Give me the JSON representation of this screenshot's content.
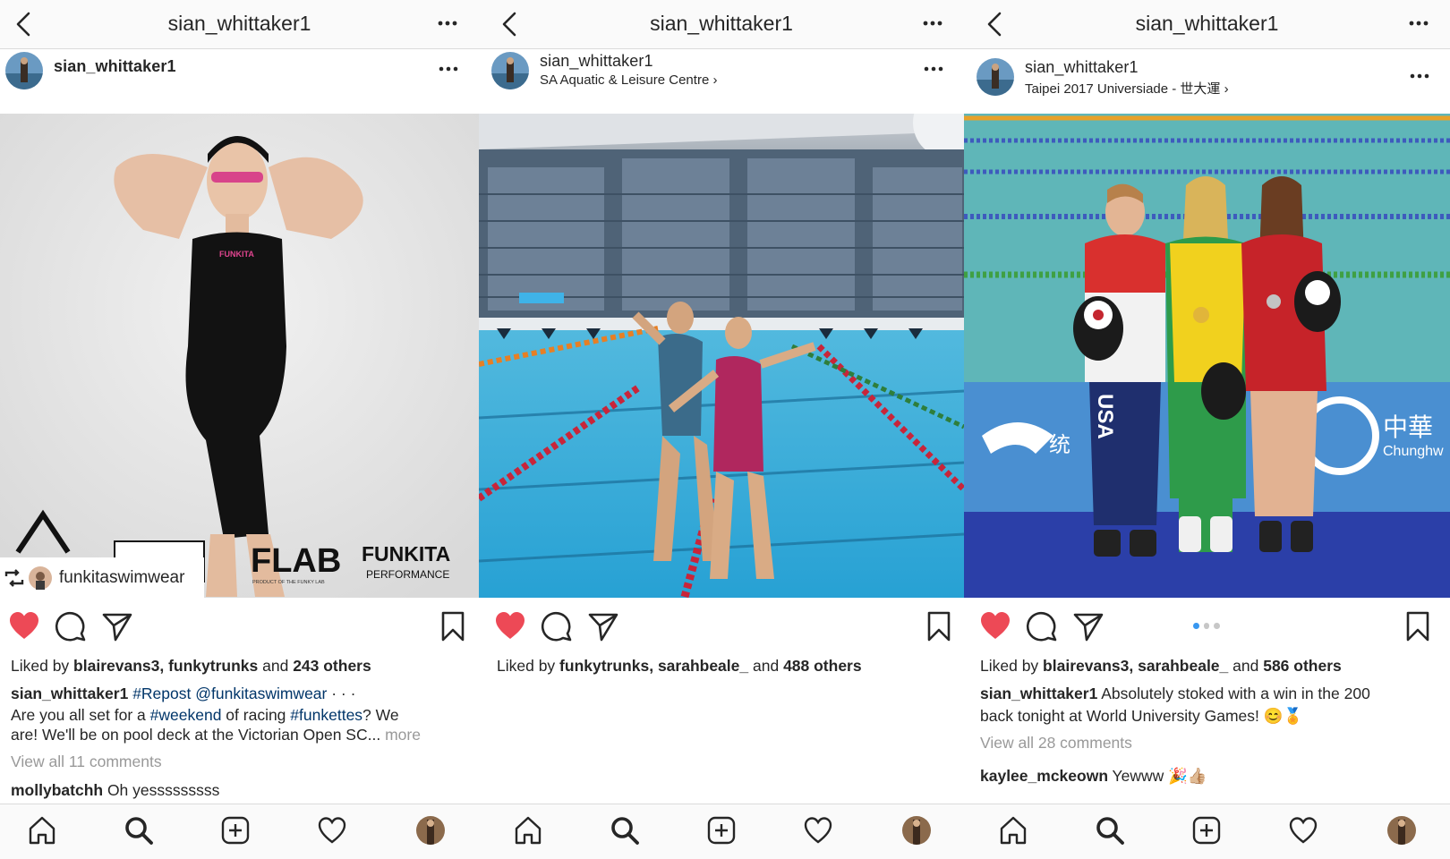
{
  "colors": {
    "like_red": "#ed4956",
    "hashtag_blue": "#003569",
    "muted_gray": "#999999",
    "pager_blue": "#3897f0"
  },
  "icons": [
    "back-arrow-icon",
    "more-dots-icon",
    "heart-filled-icon",
    "comment-icon",
    "share-icon",
    "bookmark-icon",
    "repost-icon",
    "home-icon",
    "search-icon",
    "add-post-icon",
    "activity-heart-icon",
    "profile-avatar-icon"
  ],
  "panels": [
    {
      "header_title": "sian_whittaker1",
      "username": "sian_whittaker1",
      "location": "",
      "repost_label": "funkitaswimwear",
      "photo_text": {
        "brand1": "FLAB",
        "brand1_sub": "PRODUCT OF THE FUNKY LAB",
        "brand2": "FUNKITA",
        "brand2_sub": "PERFORMANCE",
        "suit_logo": "FUNKITA"
      },
      "likes": {
        "prefix": "Liked by ",
        "user1": "blairevans3",
        "sep": ", ",
        "user2": "funkytrunks",
        "and": " and ",
        "others": "243 others"
      },
      "caption": {
        "user": "sian_whittaker1",
        "tag1": "#Repost",
        "mention": "@funkitaswimwear",
        "ellipsis": " · · ·",
        "line2_a": "Are you all set for a ",
        "tag2": "#weekend",
        "line2_b": " of racing ",
        "tag3": "#funkettes",
        "line2_c": "? We",
        "line3": "are! We'll be on pool deck at the Victorian Open SC...",
        "more": " more"
      },
      "view_comments": "View all 11 comments",
      "comment": {
        "user": "mollybatchh",
        "text": " Oh yesssssssss"
      }
    },
    {
      "header_title": "sian_whittaker1",
      "username": "sian_whittaker1",
      "location": "SA Aquatic & Leisure Centre ›",
      "likes": {
        "prefix": "Liked by ",
        "user1": "funkytrunks",
        "sep": ", ",
        "user2": "sarahbeale_",
        "and": " and ",
        "others": "488 others"
      }
    },
    {
      "header_title": "sian_whittaker1",
      "username": "sian_whittaker1",
      "location": "Taipei 2017 Universiade - 世大運 ›",
      "photo_text": {
        "banner1": "统",
        "banner2": "中華",
        "banner3": "Chunghw",
        "shirt": "USA"
      },
      "likes": {
        "prefix": "Liked by ",
        "user1": "blairevans3",
        "sep": ", ",
        "user2": "sarahbeale_",
        "and": " and ",
        "others": "586 others"
      },
      "caption": {
        "user": "sian_whittaker1",
        "line1": " Absolutely stoked with a win in the 200",
        "line2": "back tonight at World University Games! 😊🏅"
      },
      "view_comments": "View all 28 comments",
      "comment": {
        "user": "kaylee_mckeown",
        "text": " Yewww 🎉👍🏼"
      },
      "carousel": {
        "count": 3,
        "active": 1
      }
    }
  ]
}
